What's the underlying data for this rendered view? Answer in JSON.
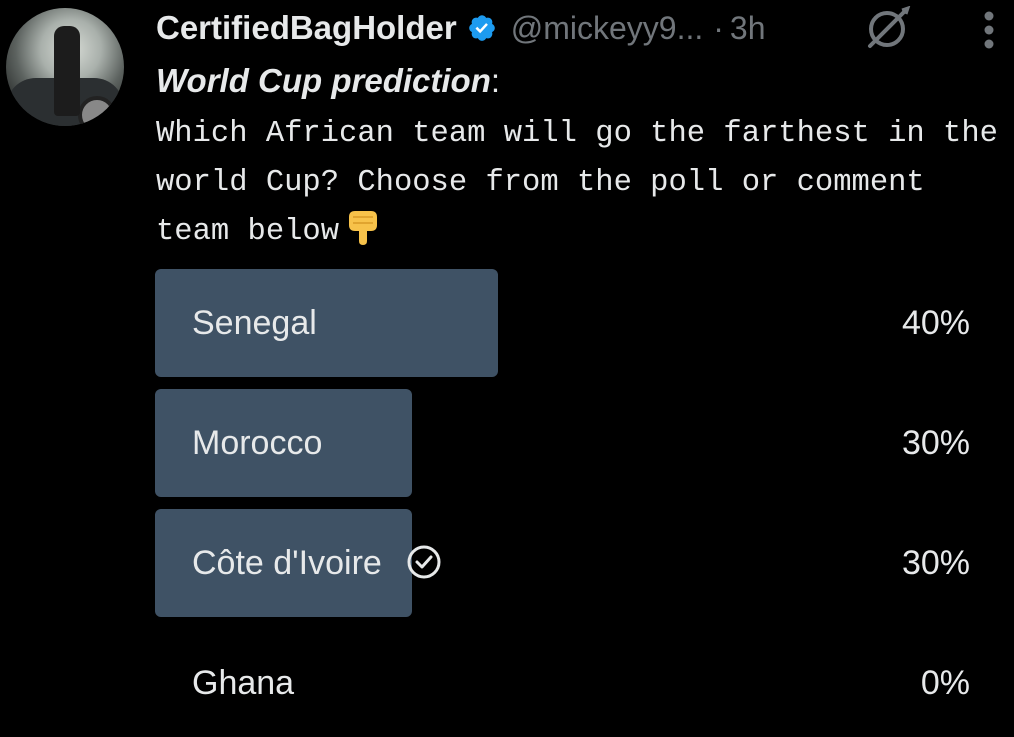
{
  "tweet": {
    "author_name": "CertifiedBagHolder",
    "handle": "@mickeyy9...",
    "separator": "·",
    "time": "3h",
    "title": "World Cup prediction",
    "title_colon": ":",
    "body": "Which African team will go the farthest in the world Cup? Choose from the poll or comment team below",
    "emoji_icon": "backhand-index-pointing-down-icon"
  },
  "poll": {
    "options": [
      {
        "label": "Senegal",
        "percent_text": "40%",
        "percent": 40
      },
      {
        "label": "Morocco",
        "percent_text": "30%",
        "percent": 30
      },
      {
        "label": "Côte d'Ivoire",
        "percent_text": "30%",
        "percent": 30,
        "voted": true
      },
      {
        "label": "Ghana",
        "percent_text": "0%",
        "percent": 0
      }
    ],
    "bar_color": "#3f5265"
  },
  "colors": {
    "background": "#000000",
    "text": "#e7e9ea",
    "muted": "#71767b",
    "verified": "#1d9bf0"
  }
}
